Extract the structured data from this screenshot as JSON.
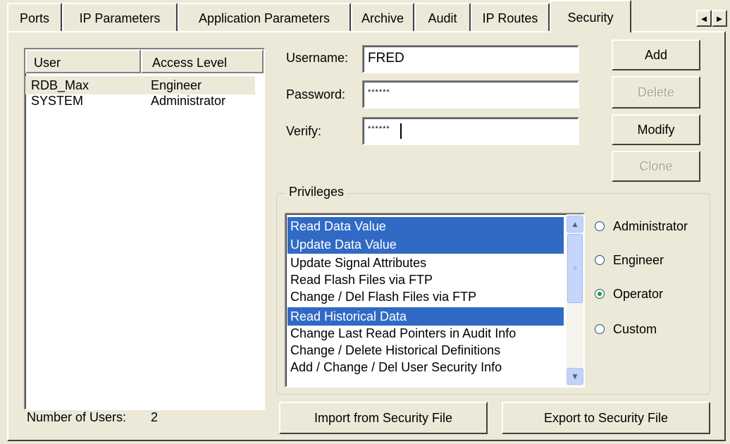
{
  "tabs": [
    "Ports",
    "IP Parameters",
    "Application Parameters",
    "Archive",
    "Audit",
    "IP Routes",
    "Security"
  ],
  "tab_scroll": {
    "left": "◄",
    "right": "►"
  },
  "users": {
    "columns": [
      "User",
      "Access Level"
    ],
    "rows": [
      {
        "user": "RDB_Max",
        "level": "Engineer"
      },
      {
        "user": "SYSTEM",
        "level": "Administrator"
      }
    ],
    "count_label": "Number of Users:",
    "count_value": "2"
  },
  "form": {
    "username_label": "Username:",
    "username_value": "FRED",
    "password_label": "Password:",
    "password_value": "******",
    "verify_label": "Verify:",
    "verify_value": "******"
  },
  "buttons": {
    "add": "Add",
    "delete": "Delete",
    "modify": "Modify",
    "clone": "Clone",
    "import": "Import from Security File",
    "export": "Export to Security File"
  },
  "privileges": {
    "title": "Privileges",
    "items": [
      "Read Data Value",
      "Update Data Value",
      "Update Signal Attributes",
      "Read Flash Files via FTP",
      "Change / Del Flash Files via FTP",
      "Read Historical Data",
      "Change Last Read Pointers in Audit Info",
      "Change / Delete Historical Definitions",
      "Add / Change / Del User Security Info"
    ],
    "roles": [
      "Administrator",
      "Engineer",
      "Operator",
      "Custom"
    ],
    "selected_role": "Operator"
  }
}
